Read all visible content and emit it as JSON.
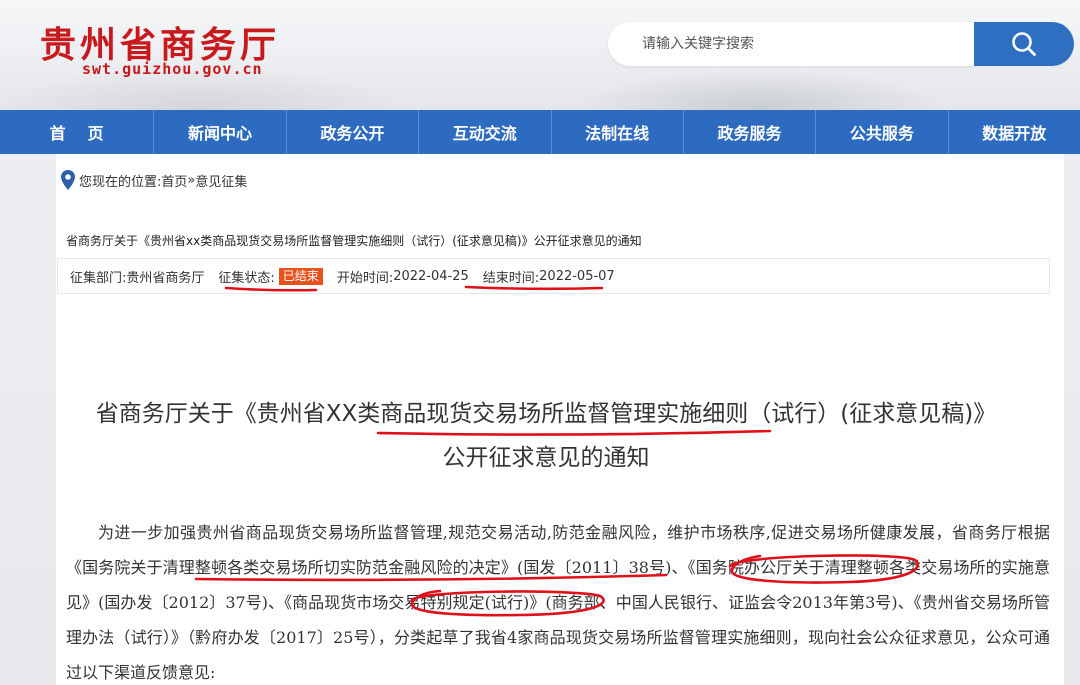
{
  "header": {
    "site_title": "贵州省商务厅",
    "site_domain": "swt.guizhou.gov.cn",
    "search_placeholder": "请输入关键字搜索",
    "search_icon": "search-icon"
  },
  "nav": {
    "items": [
      {
        "label": "首页"
      },
      {
        "label": "新闻中心"
      },
      {
        "label": "政务公开"
      },
      {
        "label": "互动交流"
      },
      {
        "label": "法制在线"
      },
      {
        "label": "政务服务"
      },
      {
        "label": "公共服务"
      },
      {
        "label": "数据开放"
      }
    ]
  },
  "breadcrumb": {
    "icon": "location-pin-icon",
    "prefix": "您现在的位置: ",
    "home": "首页",
    "separator": " » ",
    "current": "意见征集"
  },
  "notice": {
    "ref_title": "省商务厅关于《贵州省xx类商品现货交易场所监督管理实施细则（试行）(征求意见稿)》公开征求意见的通知",
    "department_label": "征集部门: ",
    "department": "贵州省商务厅",
    "status_label": "征集状态: ",
    "status": "已结束",
    "start_label": "开始时间: ",
    "start_date": "2022-04-25",
    "end_label": "结束时间: ",
    "end_date": "2022-05-07"
  },
  "document": {
    "title_line1": "省商务厅关于《贵州省XX类商品现货交易场所监督管理实施细则（试行）(征求意见稿)》",
    "title_line2": "公开征求意见的通知",
    "paragraph": "为进一步加强贵州省商品现货交易场所监督管理,规范交易活动,防范金融风险，维护市场秩序,促进交易场所健康发展，省商务厅根据《国务院关于清理整顿各类交易场所切实防范金融风险的决定》(国发〔2011〕38号)、《国务院办公厅关于清理整顿各类交易场所的实施意见》(国办发〔2012〕37号)、《商品现货市场交易特别规定(试行)》(商务部、中国人民银行、证监会令2013年第3号)、《贵州省交易场所管理办法（试行）》（黔府办发〔2017〕25号），分类起草了我省4家商品现货交易场所监督管理实施细则，现向社会公众征求意见，公众可通过以下渠道反馈意见:"
  },
  "colors": {
    "brand_red": "#c8191c",
    "nav_blue": "#2c6bbf",
    "status_orange": "#e8531d",
    "annotation_red": "#e0101a"
  }
}
